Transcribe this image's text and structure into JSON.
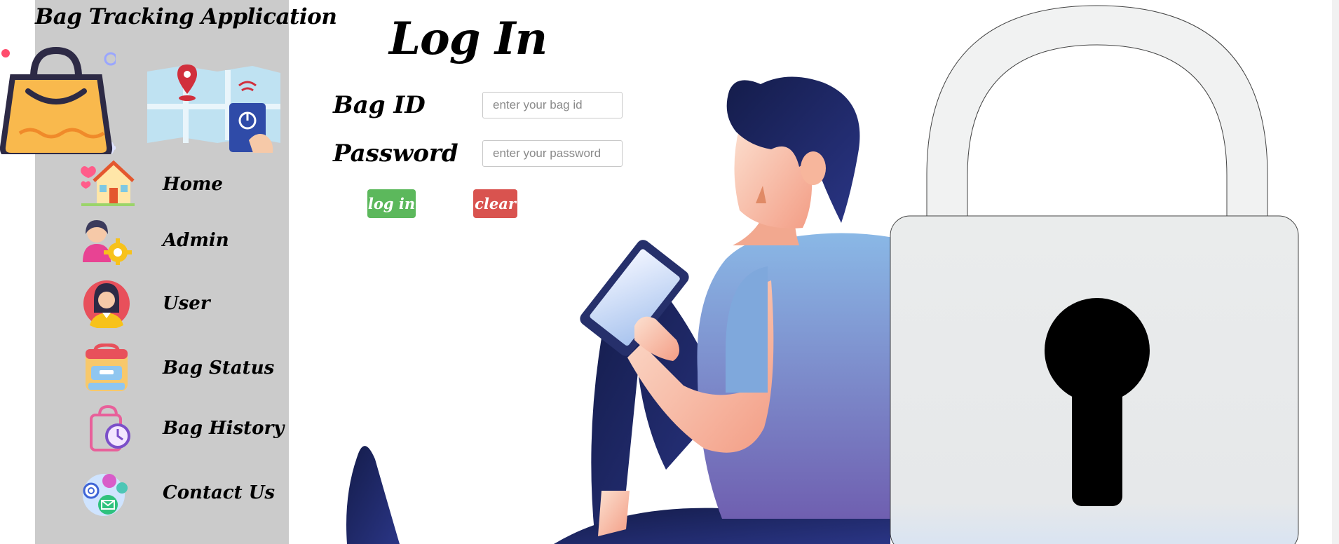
{
  "app": {
    "title": "Bag Tracking Application"
  },
  "nav": {
    "items": [
      {
        "label": "Home",
        "icon": "house-icon"
      },
      {
        "label": "Admin",
        "icon": "admin-gear-icon"
      },
      {
        "label": "User",
        "icon": "user-avatar-icon"
      },
      {
        "label": "Bag Status",
        "icon": "backpack-icon"
      },
      {
        "label": "Bag History",
        "icon": "bag-clock-icon"
      },
      {
        "label": "Contact Us",
        "icon": "contact-icon"
      }
    ]
  },
  "login": {
    "title": "Log In",
    "bag_id_label": "Bag ID",
    "bag_id_placeholder": "enter your bag id",
    "bag_id_value": "",
    "password_label": "Password",
    "password_placeholder": "enter your password",
    "password_value": "",
    "login_button": "log in",
    "clear_button": "clear"
  },
  "colors": {
    "sidebar_bg": "#cbcbcb",
    "login_button": "#5cb85c",
    "clear_button": "#d9534f",
    "bag_orange": "#f9b94d",
    "navy": "#1f2a6b"
  }
}
